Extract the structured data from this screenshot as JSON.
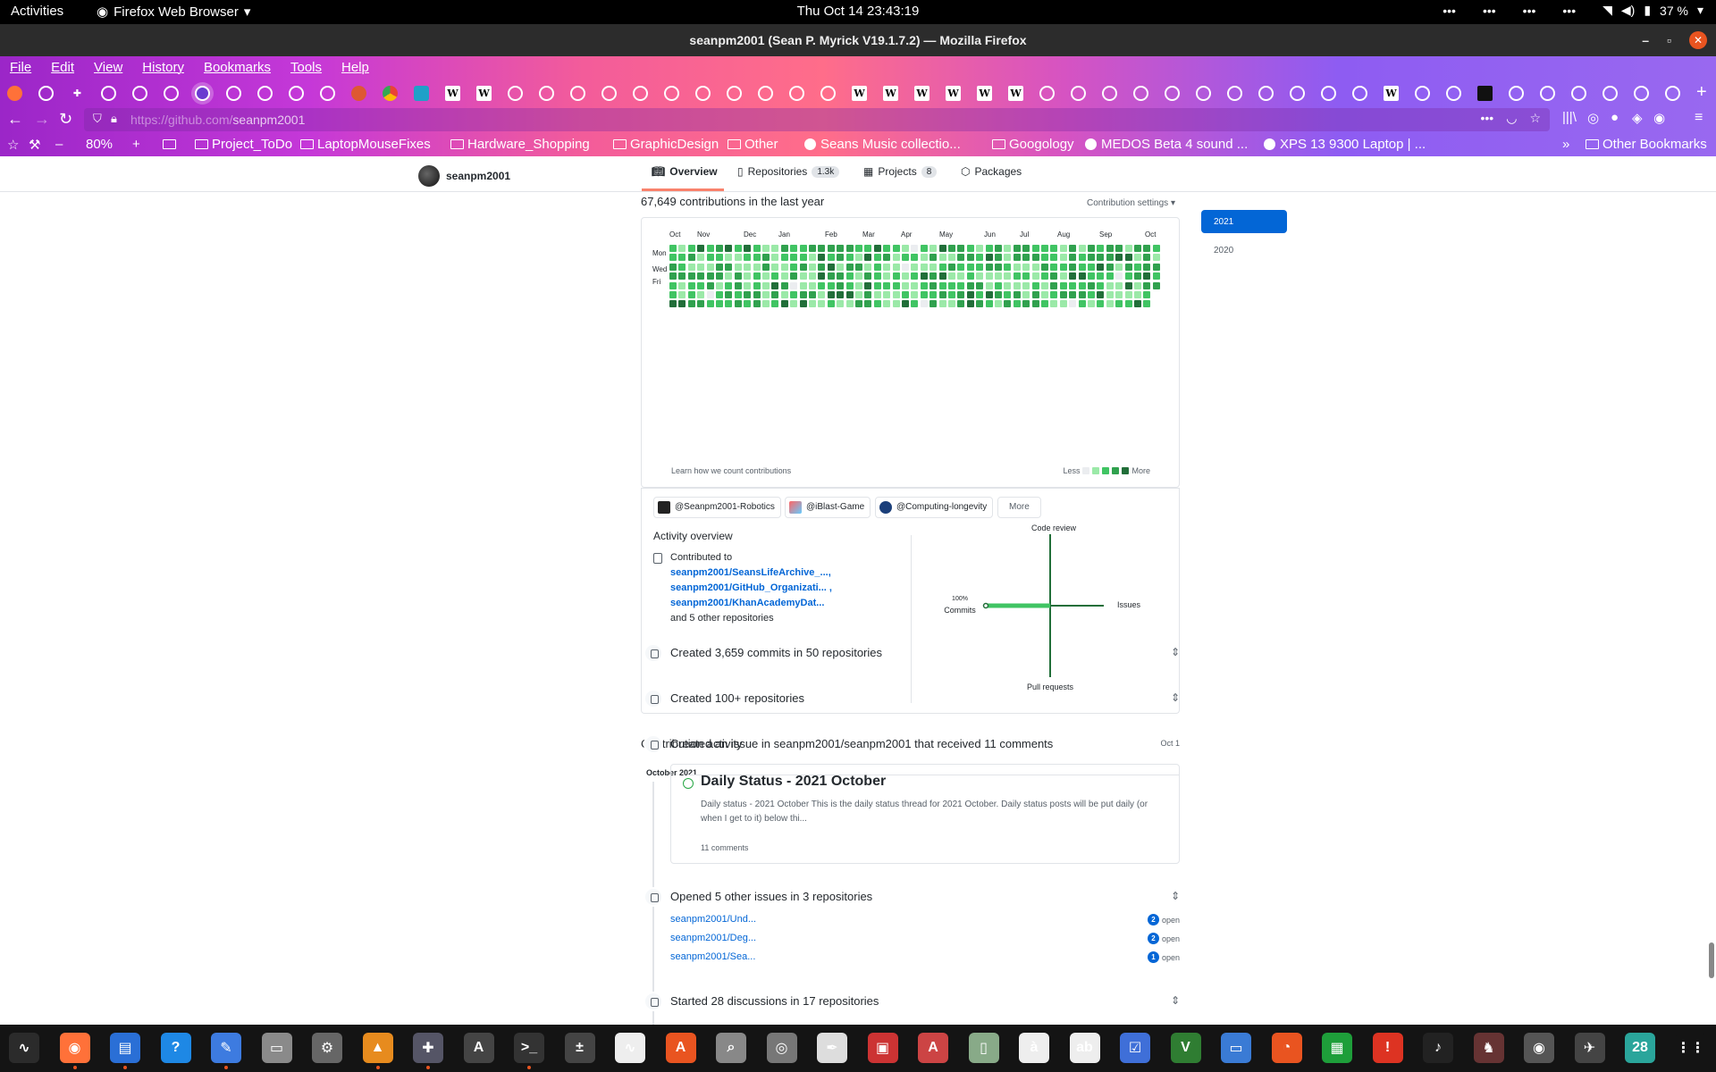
{
  "topbar": {
    "activities": "Activities",
    "app_menu": "Firefox Web Browser",
    "clock": "Thu Oct 14  23:43:19",
    "battery": "37 %"
  },
  "window": {
    "title": "seanpm2001 (Sean P. Myrick V19.1.7.2) — Mozilla Firefox"
  },
  "menubar": [
    "File",
    "Edit",
    "View",
    "History",
    "Bookmarks",
    "Tools",
    "Help"
  ],
  "navbar": {
    "url_host": "https://github.com/",
    "url_path": "seanpm2001",
    "zoom": "80%"
  },
  "bookmarks": [
    {
      "label": "Project_ToDo",
      "kind": "folder"
    },
    {
      "label": "LaptopMouseFixes",
      "kind": "folder"
    },
    {
      "label": "Hardware_Shopping",
      "kind": "folder"
    },
    {
      "label": "GraphicDesign",
      "kind": "folder"
    },
    {
      "label": "Other",
      "kind": "folder"
    },
    {
      "label": "Seans Music collectio...",
      "kind": "site"
    },
    {
      "label": "Googology",
      "kind": "folder"
    },
    {
      "label": "MEDOS Beta 4 sound ...",
      "kind": "site"
    },
    {
      "label": "XPS 13 9300 Laptop | ...",
      "kind": "site"
    },
    {
      "label": "Other Bookmarks",
      "kind": "folder"
    }
  ],
  "profile": {
    "username": "seanpm2001",
    "tabs": [
      {
        "label": "Overview",
        "count": ""
      },
      {
        "label": "Repositories",
        "count": "1.3k"
      },
      {
        "label": "Projects",
        "count": "8"
      },
      {
        "label": "Packages",
        "count": ""
      }
    ]
  },
  "contributions": {
    "header": "67,649 contributions in the last year",
    "settings": "Contribution settings ▾",
    "months": [
      "Oct",
      "Nov",
      "Dec",
      "Jan",
      "Feb",
      "Mar",
      "Apr",
      "May",
      "Jun",
      "Jul",
      "Aug",
      "Sep",
      "Oct"
    ],
    "day_labels": [
      "Mon",
      "Wed",
      "Fri"
    ],
    "footer": "Learn how we count contributions",
    "legend_less": "Less",
    "legend_more": "More",
    "colors": [
      "#ebedf0",
      "#9be9a8",
      "#40c463",
      "#30a14e",
      "#216e39"
    ]
  },
  "years": [
    "2021",
    "2020"
  ],
  "organizations": [
    "@Seanpm2001-Robotics",
    "@iBlast-Game",
    "@Computing-longevity"
  ],
  "more_button": "More",
  "activity_overview": {
    "title": "Activity overview",
    "contributed_to": "Contributed to",
    "repos": [
      "seanpm2001/SeansLifeArchive_...,",
      "seanpm2001/GitHub_Organizati... ,",
      "seanpm2001/KhanAcademyDat..."
    ],
    "other": "and 5 other repositories",
    "axes": {
      "top": "Code review",
      "right": "Issues",
      "bottom": "Pull requests",
      "left": "Commits",
      "left_pct": "100%"
    },
    "commits_fraction": 1.0
  },
  "activity": {
    "title": "Contribution activity",
    "month": "October 2021",
    "items": [
      {
        "text": "Created 3,659 commits in 50 repositories",
        "date": ""
      },
      {
        "text": "Created 100+ repositories",
        "date": ""
      },
      {
        "text": "Created an issue in seanpm2001/seanpm2001 that received 11 comments",
        "date": "Oct 1"
      },
      {
        "text": "Opened 5 other issues in 3 repositories",
        "date": ""
      },
      {
        "text": "Started 28 discussions in 17 repositories",
        "date": ""
      }
    ],
    "issue": {
      "title": "Daily Status - 2021 October",
      "body": "Daily status - 2021 October This is the daily status thread for 2021 October. Daily status posts will be put daily (or when I get to it) below thi...",
      "comments": "11 comments"
    },
    "issue_repos": [
      {
        "name": "seanpm2001/Und...",
        "count": "2",
        "state": "open"
      },
      {
        "name": "seanpm2001/Deg...",
        "count": "2",
        "state": "open"
      },
      {
        "name": "seanpm2001/Sea...",
        "count": "1",
        "state": "open"
      }
    ]
  },
  "dock": {
    "calendar_day": "28"
  }
}
